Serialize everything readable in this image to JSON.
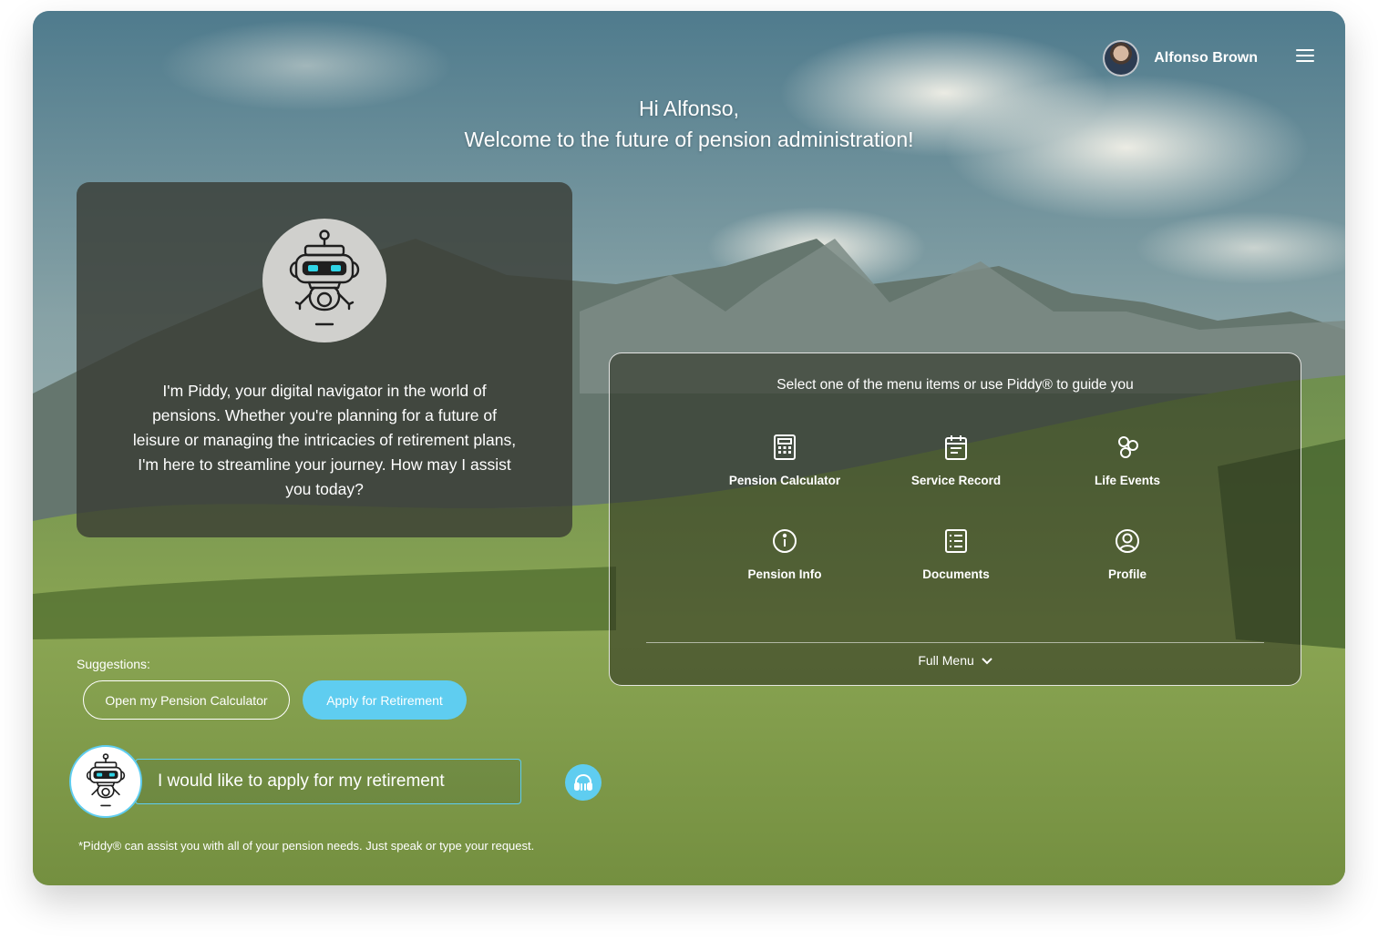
{
  "user": {
    "name": "Alfonso Brown",
    "avatar_icon": "user-avatar"
  },
  "header": {
    "menu_icon": "hamburger-menu-icon"
  },
  "greeting": {
    "line1": "Hi Alfonso,",
    "line2": "Welcome to the future of pension administration!"
  },
  "piddy": {
    "icon": "robot-icon",
    "message": "I'm Piddy, your digital navigator in the world of pensions. Whether you're planning for a future of leisure or managing the intricacies of retirement plans, I'm here to streamline your journey. How may I assist you today?"
  },
  "menu": {
    "title": "Select one of the menu items or use Piddy® to guide you",
    "items": [
      {
        "label": "Pension Calculator",
        "icon": "calculator-icon"
      },
      {
        "label": "Service Record",
        "icon": "calendar-note-icon"
      },
      {
        "label": "Life Events",
        "icon": "life-events-icon"
      },
      {
        "label": "Pension Info",
        "icon": "info-icon"
      },
      {
        "label": "Documents",
        "icon": "documents-icon"
      },
      {
        "label": "Profile",
        "icon": "profile-icon"
      }
    ],
    "full_menu_label": "Full Menu",
    "full_menu_icon": "chevron-down-icon"
  },
  "suggestions": {
    "label": "Suggestions:",
    "chips": [
      "Open my Pension Calculator",
      "Apply for Retirement"
    ]
  },
  "chat": {
    "input_value": "I would like to apply for my retirement",
    "voice_icon": "headphones-icon"
  },
  "footnote": "*Piddy®  can assist you with all of your pension needs. Just speak or type your request.",
  "colors": {
    "accent": "#5fcdf0",
    "card_dark": "#373a32"
  }
}
